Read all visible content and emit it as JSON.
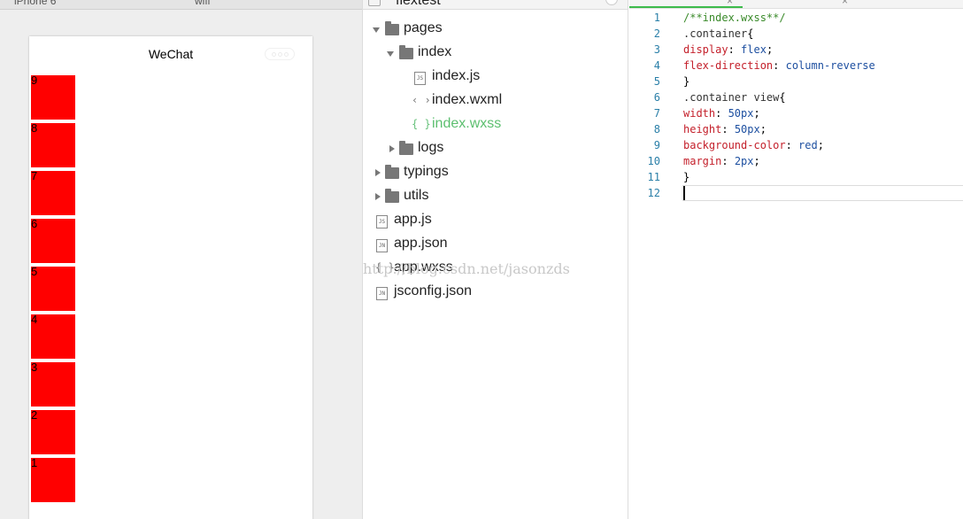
{
  "simulator": {
    "device_name": "iPhone 6",
    "network_name": "wifi",
    "nav_title": "WeChat",
    "boxes": [
      "9",
      "8",
      "7",
      "6",
      "5",
      "4",
      "3",
      "2",
      "1"
    ],
    "box_color": "#ff0000"
  },
  "file_tree": {
    "project_name": "flextest",
    "items": [
      {
        "label": "pages",
        "type": "folder",
        "expanded": true,
        "depth": 0
      },
      {
        "label": "index",
        "type": "folder",
        "expanded": true,
        "depth": 1
      },
      {
        "label": "index.js",
        "type": "file",
        "icon": "js-file-icon",
        "badge": "JS",
        "depth": 2
      },
      {
        "label": "index.wxml",
        "type": "file",
        "icon": "markup-file-icon",
        "badge": "‹ ›",
        "depth": 2
      },
      {
        "label": "index.wxss",
        "type": "file",
        "icon": "style-file-icon",
        "badge": "{ }",
        "depth": 2,
        "active": true
      },
      {
        "label": "logs",
        "type": "folder",
        "expanded": false,
        "depth": 1
      },
      {
        "label": "typings",
        "type": "folder",
        "expanded": false,
        "depth": 0
      },
      {
        "label": "utils",
        "type": "folder",
        "expanded": false,
        "depth": 0
      },
      {
        "label": "app.js",
        "type": "file",
        "icon": "js-file-icon",
        "badge": "JS",
        "depth": 0
      },
      {
        "label": "app.json",
        "type": "file",
        "icon": "json-file-icon",
        "badge": "JN",
        "depth": 0
      },
      {
        "label": "app.wxss",
        "type": "file",
        "icon": "style-file-icon",
        "badge": "{ }",
        "depth": 0
      },
      {
        "label": "jsconfig.json",
        "type": "file",
        "icon": "json-file-icon",
        "badge": "JN",
        "depth": 0
      }
    ],
    "active_color": "#5cbf6f",
    "watermark": "http://blog.csdn.net/jasonzds"
  },
  "editor": {
    "tab_close_glyph": "×",
    "lines": [
      {
        "n": "1",
        "tokens": [
          {
            "t": "/**index.wxss**/",
            "c": "comment"
          }
        ]
      },
      {
        "n": "2",
        "tokens": [
          {
            "t": ".container",
            "c": "selector"
          },
          {
            "t": "{",
            "c": "punct"
          }
        ]
      },
      {
        "n": "3",
        "tokens": [
          {
            "t": "display",
            "c": "prop"
          },
          {
            "t": ": ",
            "c": "punct"
          },
          {
            "t": "flex",
            "c": "value"
          },
          {
            "t": ";",
            "c": "punct"
          }
        ]
      },
      {
        "n": "4",
        "tokens": [
          {
            "t": "flex-direction",
            "c": "prop"
          },
          {
            "t": ": ",
            "c": "punct"
          },
          {
            "t": "column-reverse",
            "c": "value"
          }
        ]
      },
      {
        "n": "5",
        "tokens": [
          {
            "t": "}",
            "c": "punct"
          }
        ]
      },
      {
        "n": "6",
        "tokens": [
          {
            "t": ".container view",
            "c": "selector"
          },
          {
            "t": "{",
            "c": "punct"
          }
        ]
      },
      {
        "n": "7",
        "tokens": [
          {
            "t": "width",
            "c": "prop"
          },
          {
            "t": ": ",
            "c": "punct"
          },
          {
            "t": "50px",
            "c": "value"
          },
          {
            "t": ";",
            "c": "punct"
          }
        ]
      },
      {
        "n": "8",
        "tokens": [
          {
            "t": "height",
            "c": "prop"
          },
          {
            "t": ": ",
            "c": "punct"
          },
          {
            "t": "50px",
            "c": "value"
          },
          {
            "t": ";",
            "c": "punct"
          }
        ]
      },
      {
        "n": "9",
        "tokens": [
          {
            "t": "background-color",
            "c": "prop"
          },
          {
            "t": ": ",
            "c": "punct"
          },
          {
            "t": "red",
            "c": "value"
          },
          {
            "t": ";",
            "c": "punct"
          }
        ]
      },
      {
        "n": "10",
        "tokens": [
          {
            "t": "margin",
            "c": "prop"
          },
          {
            "t": ": ",
            "c": "punct"
          },
          {
            "t": "2px",
            "c": "value"
          },
          {
            "t": ";",
            "c": "punct"
          }
        ]
      },
      {
        "n": "11",
        "tokens": [
          {
            "t": "}",
            "c": "punct"
          }
        ]
      },
      {
        "n": "12",
        "tokens": []
      }
    ],
    "accent_color": "#3dbb4b"
  }
}
